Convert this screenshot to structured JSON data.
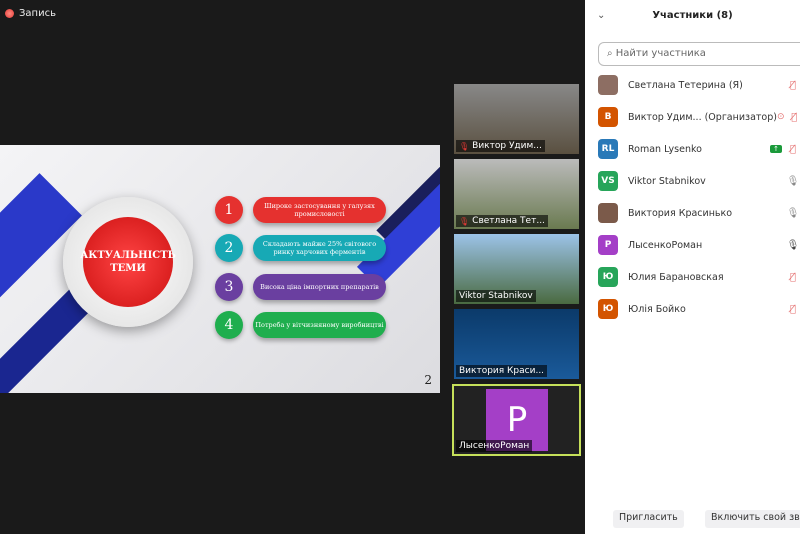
{
  "recording": {
    "label": "Запись"
  },
  "slide": {
    "title": "АКТУАЛЬНІСТЬ ТЕМИ",
    "page": "2",
    "items": [
      {
        "num": "1",
        "text": "Широке застосування у галузях промисловості",
        "color": "#e5312f"
      },
      {
        "num": "2",
        "text": "Складають майже 25% світового ринку харчових ферментів",
        "color": "#17a9b5"
      },
      {
        "num": "3",
        "text": "Висока ціна імпортних препаратів",
        "color": "#6a3fa0"
      },
      {
        "num": "4",
        "text": "Потреба у вітчизняному виробництві",
        "color": "#1fae4e"
      }
    ]
  },
  "videos": [
    {
      "name": "Виктор Удим...",
      "muted": true
    },
    {
      "name": "Светлана Тет...",
      "muted": true
    },
    {
      "name": "Viktor Stabnikov",
      "muted": false
    },
    {
      "name": "Виктория Краси...",
      "muted": false
    },
    {
      "name": "ЛысенкоРоман",
      "muted": false,
      "initial": "P"
    }
  ],
  "panel": {
    "title": "Участники (8)",
    "search_placeholder": "Найти участника",
    "participants": [
      {
        "name": "Светлана Тетерина (Я)",
        "avatar": "",
        "color": "#8d6e63",
        "mic": "muted"
      },
      {
        "name": "Виктор Удим...  (Организатор)",
        "avatar": "В",
        "color": "#d35400",
        "mic": "muted"
      },
      {
        "name": "Roman Lysenko",
        "avatar": "RL",
        "color": "#2979b8",
        "mic": "muted"
      },
      {
        "name": "Viktor Stabnikov",
        "avatar": "VS",
        "color": "#27a55a",
        "mic": "on"
      },
      {
        "name": "Виктория Красинько",
        "avatar": "",
        "color": "#7b5a4a",
        "mic": "on"
      },
      {
        "name": "ЛысенкоРоман",
        "avatar": "P",
        "color": "#a43fc7",
        "mic": "active"
      },
      {
        "name": "Юлия Барановская",
        "avatar": "Ю",
        "color": "#27a55a",
        "mic": "muted"
      },
      {
        "name": "Юлія Бойко",
        "avatar": "Ю",
        "color": "#d35400",
        "mic": "muted"
      }
    ]
  },
  "buttons": {
    "invite": "Пригласить",
    "unmute": "Включить свой звук"
  }
}
